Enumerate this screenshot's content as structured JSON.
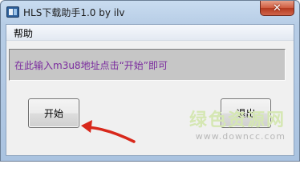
{
  "window": {
    "title": "HLS下载助手1.0 by ilv",
    "close_glyph": "✕"
  },
  "menu": {
    "items": [
      {
        "label": "帮助"
      }
    ]
  },
  "status": {
    "text": "在此输入m3u8地址点击“开始”即可"
  },
  "buttons": {
    "start_label": "开始",
    "exit_label": "退出"
  },
  "watermark": {
    "title": "绿色资源网",
    "url": "www.downcc.com"
  },
  "colors": {
    "status_text": "#7a2a9e",
    "annotation_arrow": "#d8281b"
  },
  "icons": {
    "app": "hls-app-icon",
    "close": "close-icon",
    "annotation": "red-arrow-icon"
  }
}
